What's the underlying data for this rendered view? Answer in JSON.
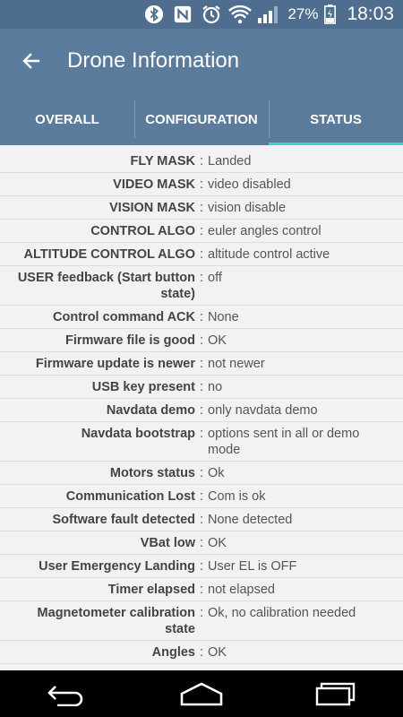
{
  "status_bar": {
    "battery_percent": "27%",
    "time": "18:03",
    "icons": [
      "bluetooth-icon",
      "nfc-icon",
      "alarm-icon",
      "wifi-icon",
      "signal-icon",
      "battery-icon"
    ]
  },
  "app_bar": {
    "title": "Drone Information",
    "back_icon": "arrow-left-icon"
  },
  "tabs": [
    {
      "label": "OVERALL",
      "active": false
    },
    {
      "label": "CONFIGURATION",
      "active": false
    },
    {
      "label": "STATUS",
      "active": true
    }
  ],
  "rows": [
    {
      "key": "FLY MASK",
      "value": "Landed"
    },
    {
      "key": "VIDEO MASK",
      "value": "video disabled"
    },
    {
      "key": "VISION MASK",
      "value": "vision disable"
    },
    {
      "key": "CONTROL ALGO",
      "value": "euler angles control"
    },
    {
      "key": "ALTITUDE CONTROL ALGO",
      "value": "altitude control active"
    },
    {
      "key": "USER feedback (Start button state)",
      "value": "off"
    },
    {
      "key": "Control command ACK",
      "value": "None"
    },
    {
      "key": "Firmware file is good",
      "value": "OK"
    },
    {
      "key": "Firmware update is newer",
      "value": "not newer"
    },
    {
      "key": "USB key present",
      "value": "no"
    },
    {
      "key": "Navdata demo",
      "value": "only navdata demo"
    },
    {
      "key": "Navdata bootstrap",
      "value": "options sent in all or demo mode"
    },
    {
      "key": "Motors status",
      "value": "Ok"
    },
    {
      "key": "Communication Lost",
      "value": "Com is ok"
    },
    {
      "key": "Software fault detected",
      "value": "None detected"
    },
    {
      "key": "VBat low",
      "value": "OK"
    },
    {
      "key": "User Emergency Landing",
      "value": "User EL is OFF"
    },
    {
      "key": "Timer elapsed",
      "value": "not elapsed"
    },
    {
      "key": "Magnetometer calibration state",
      "value": "Ok, no calibration needed"
    },
    {
      "key": "Angles",
      "value": "OK"
    }
  ],
  "separator": ":",
  "colors": {
    "status_bar": "#4f6e8f",
    "app_bar": "#5b7b9c",
    "tab_indicator": "#3fd0d0",
    "background": "#f2f2f2"
  }
}
